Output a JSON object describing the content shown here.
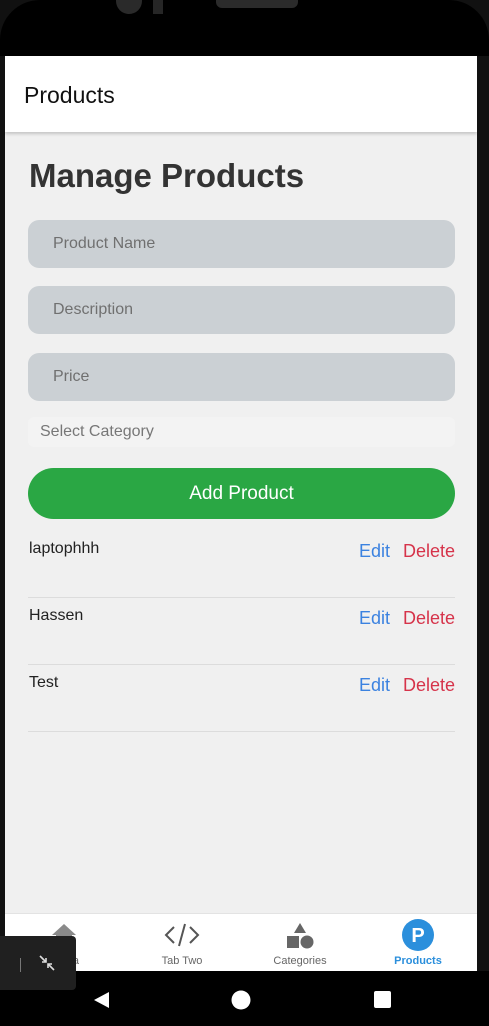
{
  "appbar": {
    "title": "Products"
  },
  "main": {
    "heading": "Manage Products",
    "fields": {
      "product_name_placeholder": "Product Name",
      "description_placeholder": "Description",
      "price_placeholder": "Price"
    },
    "select_category": "Select Category",
    "add_button": "Add Product",
    "products": [
      {
        "name": "laptophhh",
        "edit": "Edit",
        "delete": "Delete"
      },
      {
        "name": "Hassen",
        "edit": "Edit",
        "delete": "Delete"
      },
      {
        "name": "Test",
        "edit": "Edit",
        "delete": "Delete"
      }
    ]
  },
  "tabs": [
    {
      "label": "Media",
      "icon": "home-icon",
      "active": false
    },
    {
      "label": "Tab Two",
      "icon": "code-icon",
      "active": false
    },
    {
      "label": "Categories",
      "icon": "shapes-icon",
      "active": false
    },
    {
      "label": "Products",
      "icon": "p-circle-icon",
      "active": true
    }
  ],
  "colors": {
    "accent": "#2b8fdc",
    "add_button": "#2aa744",
    "edit": "#3b82e0",
    "delete": "#d6334a",
    "input_bg": "#cbd0d4"
  },
  "system_nav": [
    "back-icon",
    "home-circle-icon",
    "recents-icon"
  ]
}
